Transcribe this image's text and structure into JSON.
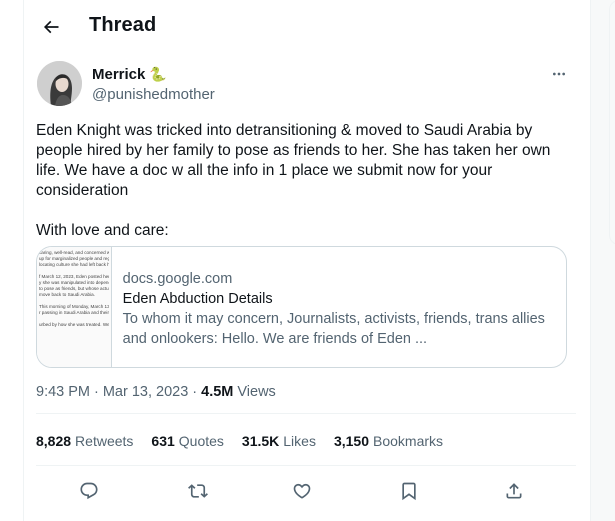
{
  "header": {
    "title": "Thread",
    "back_icon": "arrow-left-icon"
  },
  "author": {
    "name": "Merrick",
    "name_emoji": "🐍",
    "handle": "@punishedmother",
    "avatar": "user-avatar"
  },
  "tweet": {
    "paragraphs": [
      "Eden Knight was tricked into detransitioning & moved to Saudi Arabia by people hired by her family to pose as friends to her. She has taken her own life. We have a doc w all the info in 1 place we submit now for your consideration",
      "With love and care:"
    ]
  },
  "link_card": {
    "domain": "docs.google.com",
    "title": "Eden Abduction Details",
    "description": "To whom it may concern, Journalists, activists, friends, trans allies and onlookers: Hello. We are friends of Eden ...",
    "thumbnail_lines": [
      "caring, well-read, and concerned with making the w",
      "up for marginalized people and regularly critiqued t",
      "locating culture she had left back home.",
      "",
      "f March 12, 2023, Eden posted her suicide note on",
      "y she was manipulated into depending on people hi",
      "to pose as friends, but whose actual goal was to fo",
      "move back to Saudi Arabia.",
      "",
      "This morning of Monday, March 13th, 2023 Eden's",
      "r passing in Saudi Arabia and their identity.",
      "",
      "urbed by how she was treated. We believe that wh"
    ]
  },
  "meta": {
    "time": "9:43 PM",
    "separator1": "·",
    "date": "Mar 13, 2023",
    "separator2": "·",
    "views_count": "4.5M",
    "views_label": "Views"
  },
  "stats": [
    {
      "count": "8,828",
      "label": "Retweets"
    },
    {
      "count": "631",
      "label": "Quotes"
    },
    {
      "count": "31.5K",
      "label": "Likes"
    },
    {
      "count": "3,150",
      "label": "Bookmarks"
    }
  ],
  "actions": [
    "reply-icon",
    "retweet-icon",
    "like-icon",
    "bookmark-icon",
    "share-icon"
  ],
  "colors": {
    "text": "#0f1419",
    "secondary": "#536471",
    "border": "#cfd9de",
    "divider": "#eff3f4"
  }
}
